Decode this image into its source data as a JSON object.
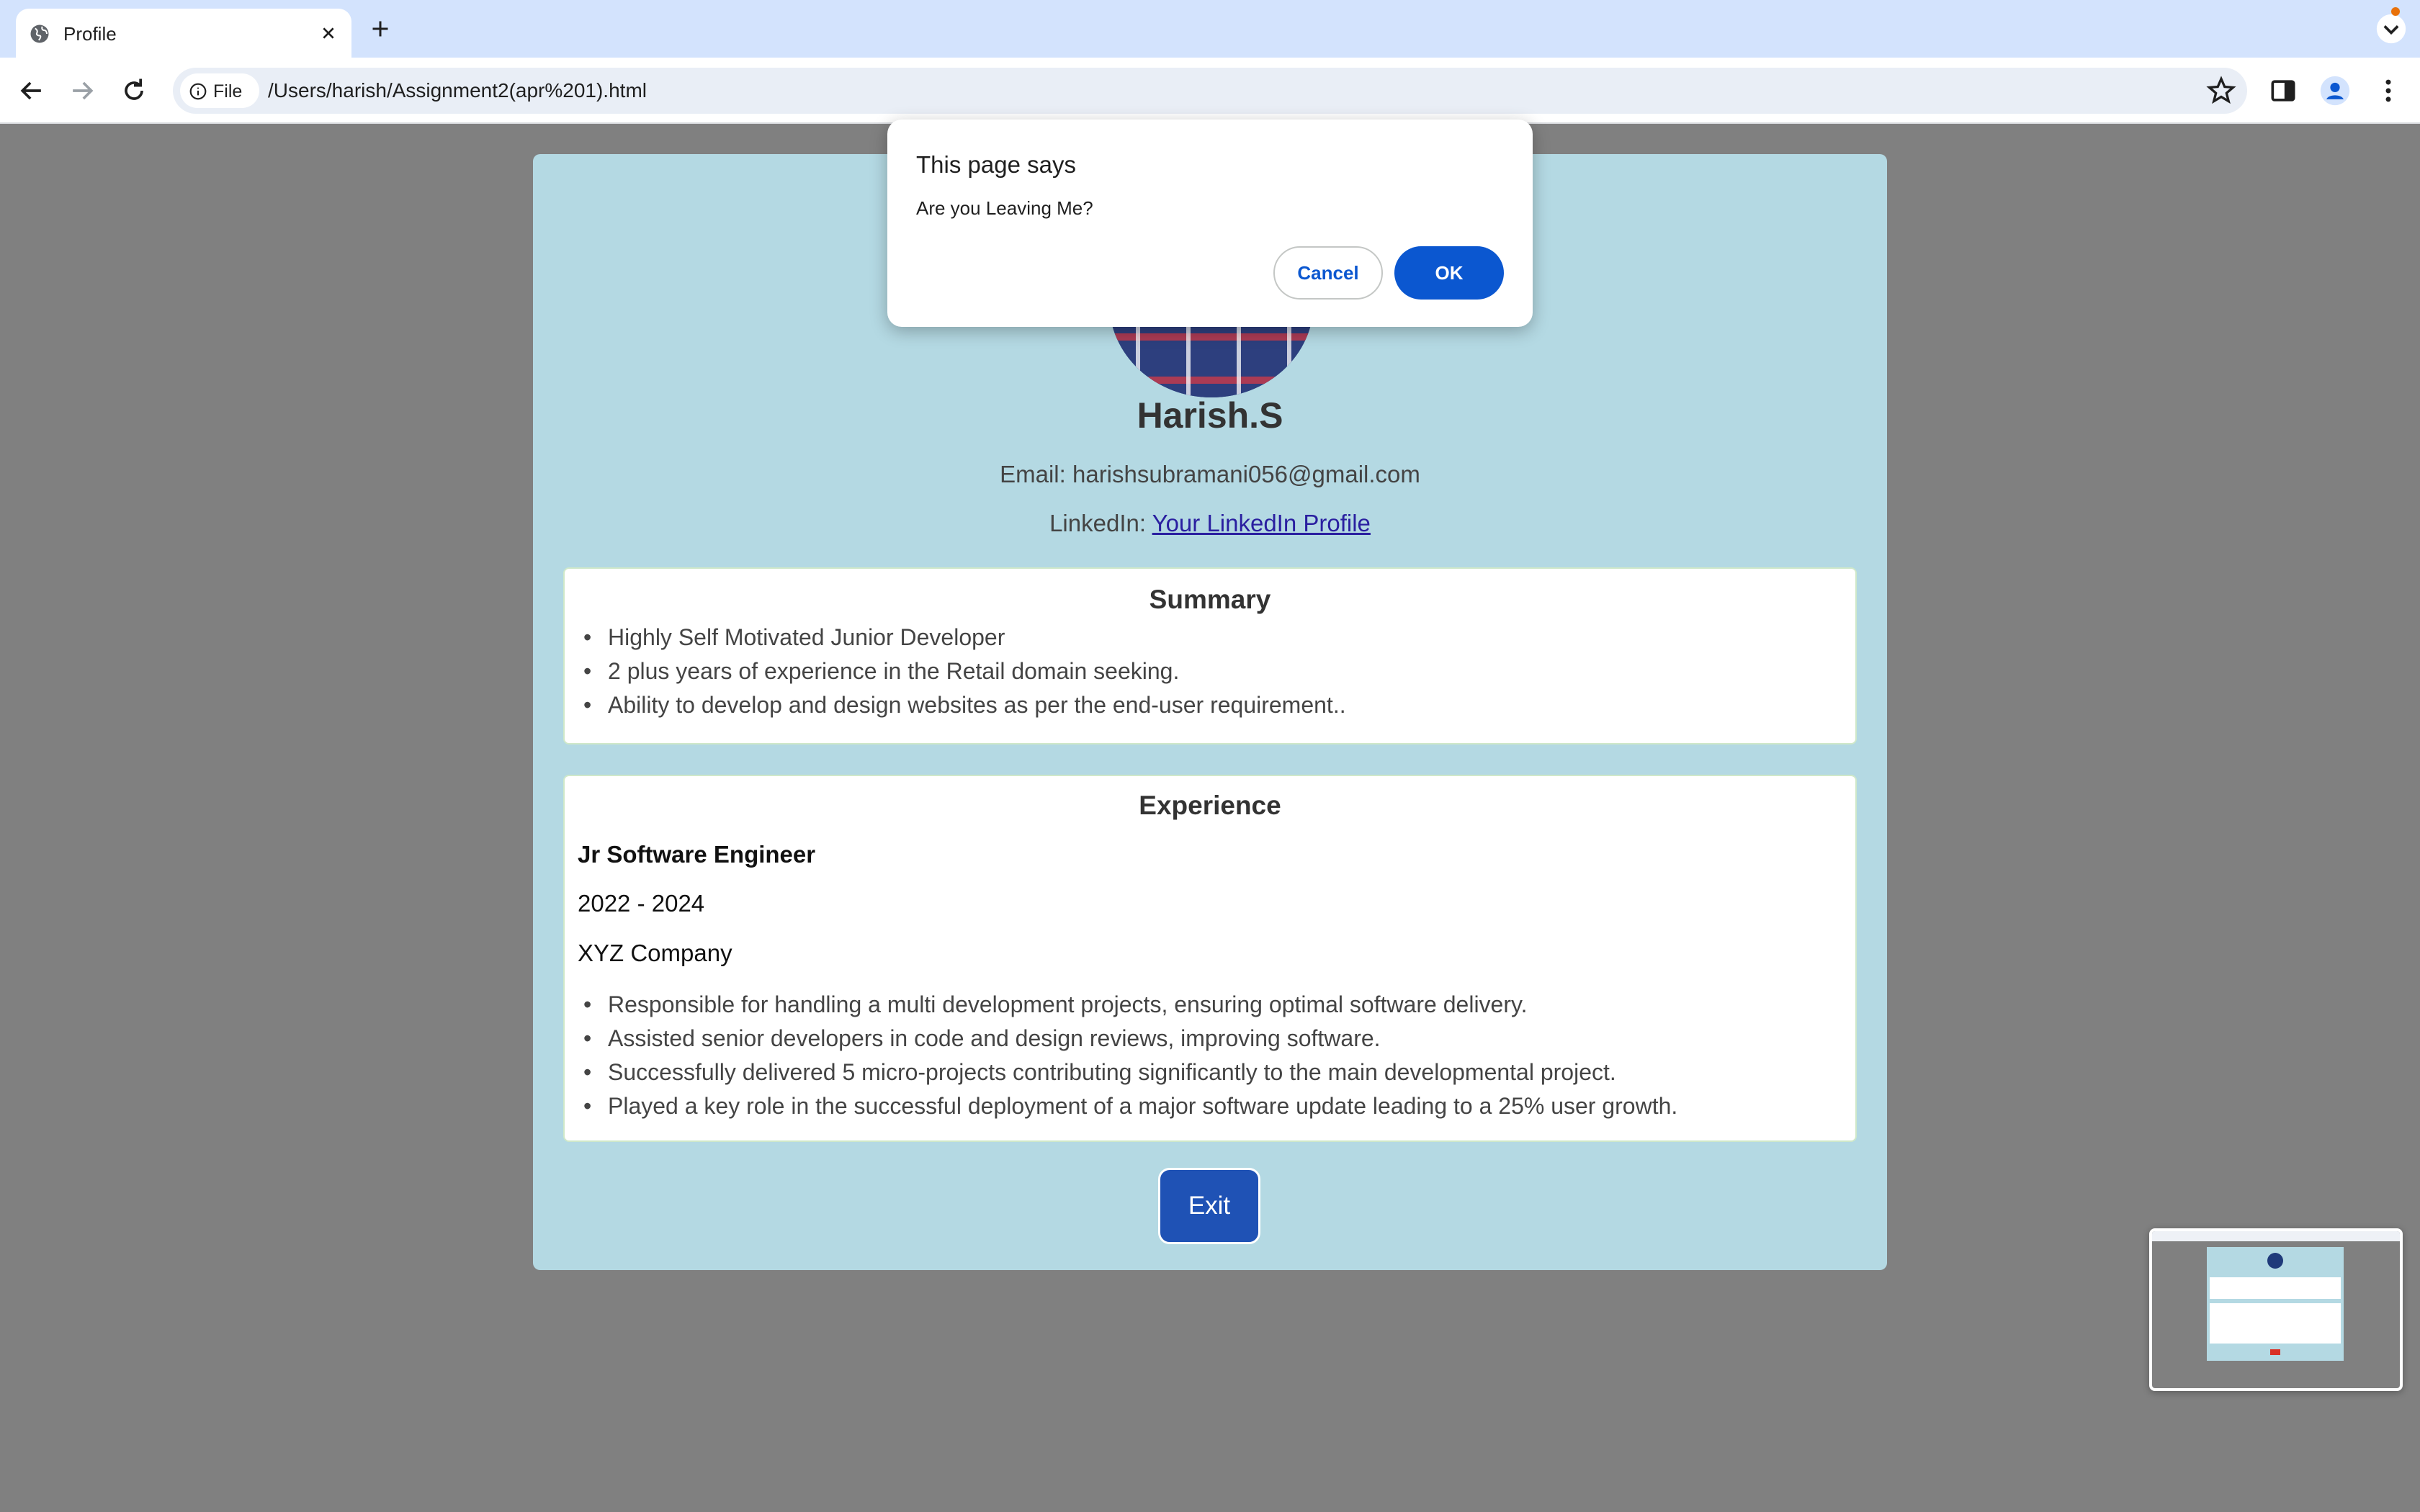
{
  "browser": {
    "tab_title": "Profile",
    "site_chip": "File",
    "url": "/Users/harish/Assignment2(apr%201).html"
  },
  "profile": {
    "name": "Harish.S",
    "email_label": "Email: ",
    "email": "harishsubramani056@gmail.com",
    "linkedin_label": "LinkedIn: ",
    "linkedin_link_text": "Your LinkedIn Profile"
  },
  "summary": {
    "title": "Summary",
    "items": [
      "Highly Self Motivated Junior Developer",
      "2 plus years of experience in the Retail domain seeking.",
      "Ability to develop and design websites as per the end-user requirement.."
    ]
  },
  "experience": {
    "title": "Experience",
    "job_title": "Jr Software Engineer",
    "years": "2022 - 2024",
    "company": "XYZ Company",
    "items": [
      "Responsible for handling a multi development projects, ensuring optimal software delivery.",
      "Assisted senior developers in code and design reviews, improving software.",
      "Successfully delivered 5 micro-projects contributing significantly to the main developmental project.",
      "Played a key role in the successful deployment of a major software update leading to a 25% user growth."
    ]
  },
  "exit_label": "Exit",
  "dialog": {
    "title": "This page says",
    "message": "Are you Leaving Me?",
    "cancel_label": "Cancel",
    "ok_label": "OK"
  },
  "colors": {
    "page_bg": "#808080",
    "card_bg": "#b4d9e3",
    "exit_button": "#1f52b5",
    "dialog_accent": "#0b57d0",
    "link": "#2a1fa0"
  }
}
